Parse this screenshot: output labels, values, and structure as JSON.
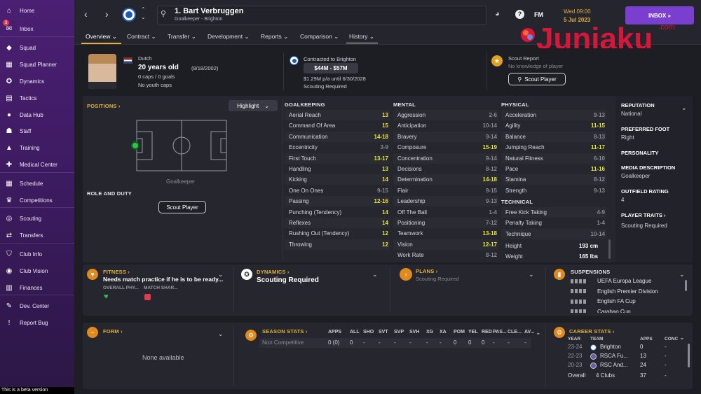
{
  "sidebar": {
    "inbox_count": "3",
    "items": [
      {
        "label": "Home",
        "icon": "home-icon",
        "glyph": "⌂"
      },
      {
        "label": "Inbox",
        "icon": "inbox-icon",
        "glyph": "✉"
      },
      {
        "label": "Squad",
        "icon": "shirt-icon",
        "glyph": "◆"
      },
      {
        "label": "Squad Planner",
        "icon": "planner-icon",
        "glyph": "▦"
      },
      {
        "label": "Dynamics",
        "icon": "dynamics-icon",
        "glyph": "✪"
      },
      {
        "label": "Tactics",
        "icon": "tactics-icon",
        "glyph": "▤"
      },
      {
        "label": "Data Hub",
        "icon": "data-hub-icon",
        "glyph": "●"
      },
      {
        "label": "Staff",
        "icon": "staff-icon",
        "glyph": "☗"
      },
      {
        "label": "Training",
        "icon": "training-icon",
        "glyph": "▲"
      },
      {
        "label": "Medical Center",
        "icon": "medical-icon",
        "glyph": "✚"
      },
      {
        "label": "Schedule",
        "icon": "calendar-icon",
        "glyph": "▦"
      },
      {
        "label": "Competitions",
        "icon": "trophy-icon",
        "glyph": "♛"
      },
      {
        "label": "Scouting",
        "icon": "scouting-icon",
        "glyph": "◎"
      },
      {
        "label": "Transfers",
        "icon": "transfers-icon",
        "glyph": "⇄"
      },
      {
        "label": "Club Info",
        "icon": "shield-icon",
        "glyph": "⛉"
      },
      {
        "label": "Club Vision",
        "icon": "vision-icon",
        "glyph": "◉"
      },
      {
        "label": "Finances",
        "icon": "finances-icon",
        "glyph": "▥"
      },
      {
        "label": "Dev. Center",
        "icon": "dev-center-icon",
        "glyph": "✎"
      },
      {
        "label": "Report Bug",
        "icon": "bug-icon",
        "glyph": "!"
      }
    ],
    "beta_text": "This is a beta version"
  },
  "header": {
    "player_name": "1. Bart Verbruggen",
    "player_sub": "Goalkeeper - Brighton",
    "help": "?",
    "fm": "FM",
    "day_time": "Wed 09:00",
    "date": "5 Jul 2023",
    "inbox_label": "INBOX  »"
  },
  "tabs": [
    "Overview ⌄",
    "Contract ⌄",
    "Transfer ⌄",
    "Development ⌄",
    "Reports ⌄",
    "Comparison ⌄",
    "History ⌄"
  ],
  "logo": {
    "text": "Juniaku",
    "dotcom": ".com",
    "color": "#d6173a"
  },
  "info": {
    "nationality": "Dutch",
    "age": "20 years old",
    "dob": "(8/18/2002)",
    "caps": "0 caps / 0 goals",
    "youth_caps": "No youth caps",
    "contracted": "Contracted to Brighton",
    "value": "$44M - $57M",
    "wage": "$1.29M p/a until 6/30/2028",
    "scouting_required": "Scouting Required",
    "scout_report": "Scout Report",
    "no_knowledge": "No knowledge of player",
    "scout_btn": "Scout Player"
  },
  "positions": {
    "title": "POSITIONS ›",
    "highlight": "Highlight",
    "position_label": "Goalkeeper",
    "role_duty": "ROLE AND DUTY",
    "scout_btn": "Scout Player"
  },
  "goalkeeping": {
    "title": "GOALKEEPING",
    "rows": [
      {
        "name": "Aerial Reach",
        "value": "13",
        "hl": true
      },
      {
        "name": "Command Of Area",
        "value": "15",
        "hl": true
      },
      {
        "name": "Communication",
        "value": "14-18",
        "hl": true
      },
      {
        "name": "Eccentricity",
        "value": "3-9",
        "hl": false
      },
      {
        "name": "First Touch",
        "value": "13-17",
        "hl": true
      },
      {
        "name": "Handling",
        "value": "13",
        "hl": true
      },
      {
        "name": "Kicking",
        "value": "14",
        "hl": true
      },
      {
        "name": "One On Ones",
        "value": "9-15",
        "hl": false
      },
      {
        "name": "Passing",
        "value": "12-16",
        "hl": true
      },
      {
        "name": "Punching (Tendency)",
        "value": "14",
        "hl": true
      },
      {
        "name": "Reflexes",
        "value": "14",
        "hl": true
      },
      {
        "name": "Rushing Out (Tendency)",
        "value": "12",
        "hl": true
      },
      {
        "name": "Throwing",
        "value": "12",
        "hl": true
      }
    ]
  },
  "mental": {
    "title": "MENTAL",
    "rows": [
      {
        "name": "Aggression",
        "value": "2-6",
        "hl": false
      },
      {
        "name": "Anticipation",
        "value": "10-14",
        "hl": false
      },
      {
        "name": "Bravery",
        "value": "9-14",
        "hl": false
      },
      {
        "name": "Composure",
        "value": "15-19",
        "hl": true
      },
      {
        "name": "Concentration",
        "value": "9-14",
        "hl": false
      },
      {
        "name": "Decisions",
        "value": "8-12",
        "hl": false
      },
      {
        "name": "Determination",
        "value": "14-18",
        "hl": true
      },
      {
        "name": "Flair",
        "value": "9-15",
        "hl": false
      },
      {
        "name": "Leadership",
        "value": "9-13",
        "hl": false
      },
      {
        "name": "Off The Ball",
        "value": "1-4",
        "hl": false
      },
      {
        "name": "Positioning",
        "value": "7-12",
        "hl": false
      },
      {
        "name": "Teamwork",
        "value": "13-18",
        "hl": true
      },
      {
        "name": "Vision",
        "value": "12-17",
        "hl": true
      },
      {
        "name": "Work Rate",
        "value": "8-12",
        "hl": false
      }
    ]
  },
  "physical": {
    "title": "PHYSICAL",
    "rows": [
      {
        "name": "Acceleration",
        "value": "9-13",
        "hl": false
      },
      {
        "name": "Agility",
        "value": "11-15",
        "hl": true
      },
      {
        "name": "Balance",
        "value": "8-13",
        "hl": false
      },
      {
        "name": "Jumping Reach",
        "value": "11-17",
        "hl": true
      },
      {
        "name": "Natural Fitness",
        "value": "6-10",
        "hl": false
      },
      {
        "name": "Pace",
        "value": "11-16",
        "hl": true
      },
      {
        "name": "Stamina",
        "value": "8-12",
        "hl": false
      },
      {
        "name": "Strength",
        "value": "9-13",
        "hl": false
      }
    ]
  },
  "technical": {
    "title": "TECHNICAL",
    "rows": [
      {
        "name": "Free Kick Taking",
        "value": "4-9",
        "hl": false
      },
      {
        "name": "Penalty Taking",
        "value": "1-4",
        "hl": false
      },
      {
        "name": "Technique",
        "value": "10-14",
        "hl": false
      }
    ],
    "height_label": "Height",
    "height": "193 cm",
    "weight_label": "Weight",
    "weight": "165 lbs"
  },
  "side_info": {
    "reputation_h": "REPUTATION",
    "reputation": "National",
    "foot_h": "PREFERRED FOOT",
    "foot": "Right",
    "personality_h": "PERSONALITY",
    "media_h": "MEDIA DESCRIPTION",
    "media": "Goalkeeper",
    "outfield_h": "OUTFIELD RATING",
    "outfield": "4",
    "traits_h": "PLAYER TRAITS ›",
    "traits": "Scouting Required"
  },
  "fitness": {
    "title": "FITNESS ›",
    "text": "Needs match practice if he is to be ready...",
    "col1": "OVERALL PHY...",
    "col2": "MATCH SHAR..."
  },
  "dynamics": {
    "title": "DYNAMICS ›",
    "text": "Scouting Required"
  },
  "plans": {
    "title": "PLANS ›",
    "text": "Scouting Required"
  },
  "suspensions": {
    "title": "SUSPENSIONS",
    "items": [
      "UEFA Europa League",
      "English Premier Division",
      "English FA Cup",
      "Carabao Cup"
    ]
  },
  "form": {
    "title": "FORM ›",
    "empty": "None available"
  },
  "season_stats": {
    "title": "SEASON STATS ›",
    "headers": [
      "APPS",
      "ALL",
      "SHO",
      "SVT",
      "SVP",
      "SVH",
      "XG",
      "XA",
      "POM",
      "YEL",
      "RED",
      "PAS...",
      "CLE...",
      "AV..."
    ],
    "row_label": "Non Competitive",
    "row": [
      "0 (0)",
      "0",
      "-",
      "-",
      "-",
      "-",
      "-",
      "-",
      "0",
      "0",
      "0",
      "-",
      "-",
      "-"
    ]
  },
  "career_stats": {
    "title": "CAREER STATS ›",
    "headers": [
      "YEAR",
      "TEAM",
      "APPS",
      "CONC"
    ],
    "rows": [
      {
        "year": "23-24",
        "team": "Brighton",
        "apps": "0",
        "conc": "-"
      },
      {
        "year": "22-23",
        "team": "RSCA Fu...",
        "apps": "13",
        "conc": "-"
      },
      {
        "year": "20-23",
        "team": "RSC And...",
        "apps": "24",
        "conc": "-"
      }
    ],
    "overall_label": "Overall",
    "overall_team": "4 Clubs",
    "overall_apps": "37",
    "overall_conc": "-"
  }
}
